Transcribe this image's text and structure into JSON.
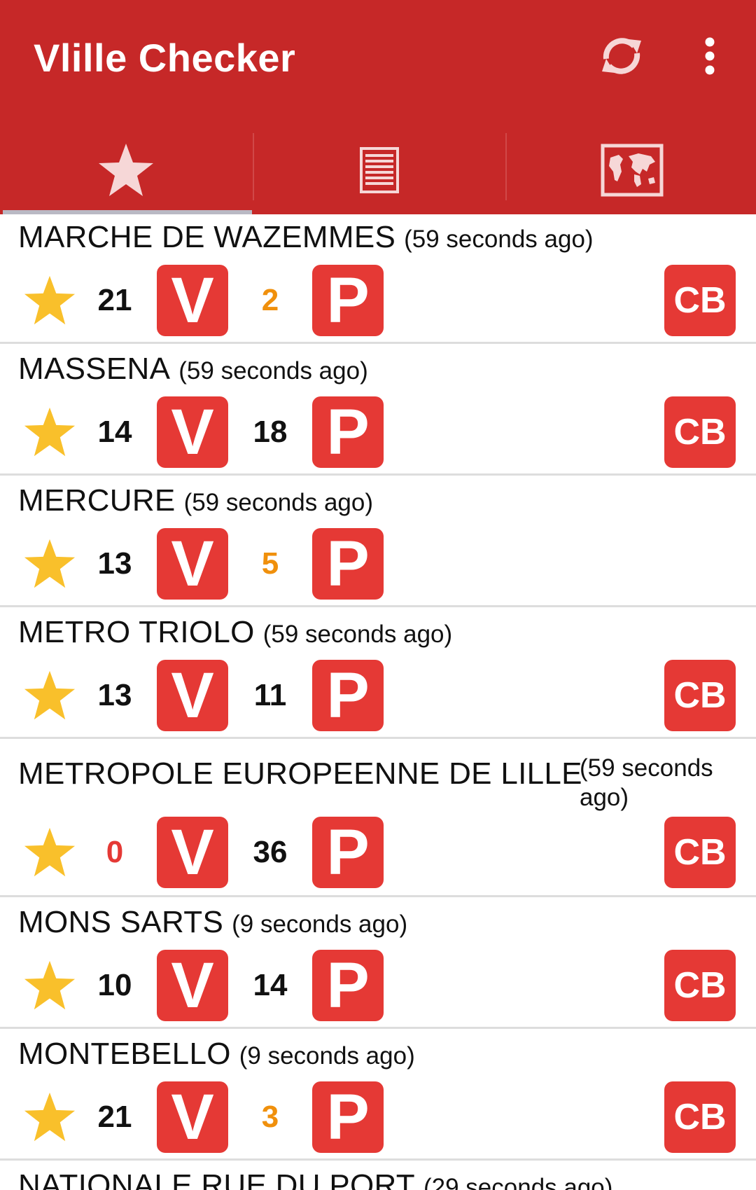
{
  "app": {
    "title": "Vlille Checker",
    "refresh_icon": "refresh-icon",
    "overflow_icon": "more-vert-icon"
  },
  "tabs": [
    {
      "icon": "star-icon",
      "selected": true
    },
    {
      "icon": "list-icon",
      "selected": false
    },
    {
      "icon": "map-icon",
      "selected": false
    }
  ],
  "labels": {
    "bikes_badge": "V",
    "parking_badge": "P",
    "card_badge": "CB"
  },
  "colors": {
    "app_bar": "#c62828",
    "badge": "#e53935",
    "star": "#f9c02b",
    "count_normal": "#111111",
    "count_low": "#f0900c",
    "count_empty": "#e53935"
  },
  "stations": [
    {
      "name": "MARCHE DE WAZEMMES",
      "ago": "(59 seconds ago)",
      "bikes": "21",
      "bikes_status": "normal",
      "slots": "2",
      "slots_status": "low",
      "cb": true
    },
    {
      "name": "MASSENA",
      "ago": "(59 seconds ago)",
      "bikes": "14",
      "bikes_status": "normal",
      "slots": "18",
      "slots_status": "normal",
      "cb": true
    },
    {
      "name": "MERCURE",
      "ago": "(59 seconds ago)",
      "bikes": "13",
      "bikes_status": "normal",
      "slots": "5",
      "slots_status": "low",
      "cb": false
    },
    {
      "name": "METRO TRIOLO",
      "ago": "(59 seconds ago)",
      "bikes": "13",
      "bikes_status": "normal",
      "slots": "11",
      "slots_status": "normal",
      "cb": true
    },
    {
      "name": "METROPOLE EUROPEENNE DE LILLE",
      "ago_line1": "(59 seconds",
      "ago_line2": "ago)",
      "bikes": "0",
      "bikes_status": "empty",
      "slots": "36",
      "slots_status": "normal",
      "cb": true
    },
    {
      "name": "MONS SARTS",
      "ago": "(9 seconds ago)",
      "bikes": "10",
      "bikes_status": "normal",
      "slots": "14",
      "slots_status": "normal",
      "cb": true
    },
    {
      "name": "MONTEBELLO",
      "ago": "(9 seconds ago)",
      "bikes": "21",
      "bikes_status": "normal",
      "slots": "3",
      "slots_status": "low",
      "cb": true
    },
    {
      "name": "NATIONALE RUE DU PORT",
      "ago": "(29 seconds ago)"
    }
  ]
}
